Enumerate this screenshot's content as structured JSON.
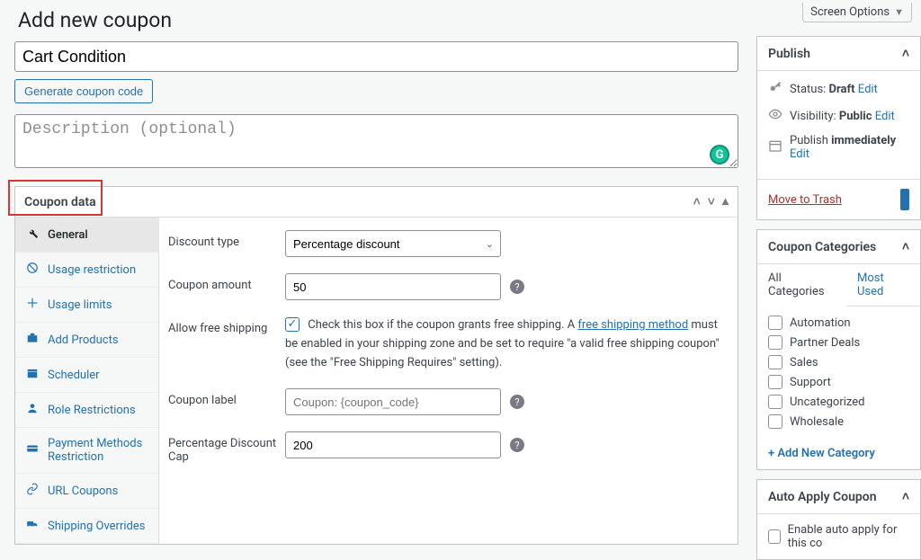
{
  "screen_options_label": "Screen Options",
  "page_title": "Add new coupon",
  "title_value": "Cart Condition",
  "generate_label": "Generate coupon code",
  "description_placeholder": "Description (optional)",
  "coupon_data_head": "Coupon data",
  "tabs": {
    "general": "General",
    "usage_restriction": "Usage restriction",
    "usage_limits": "Usage limits",
    "add_products": "Add Products",
    "scheduler": "Scheduler",
    "role_restrictions": "Role Restrictions",
    "payment_methods": "Payment Methods Restriction",
    "url_coupons": "URL Coupons",
    "shipping_overrides": "Shipping Overrides"
  },
  "form": {
    "discount_type_label": "Discount type",
    "discount_type_value": "Percentage discount",
    "coupon_amount_label": "Coupon amount",
    "coupon_amount_value": "50",
    "free_shipping_label": "Allow free shipping",
    "free_shipping_text_before": "Check this box if the coupon grants free shipping. A ",
    "free_shipping_link": "free shipping method",
    "free_shipping_text_after": " must be enabled in your shipping zone and be set to require \"a valid free shipping coupon\" (see the \"Free Shipping Requires\" setting).",
    "coupon_label_label": "Coupon label",
    "coupon_label_placeholder": "Coupon: {coupon_code}",
    "percentage_cap_label": "Percentage Discount Cap",
    "percentage_cap_value": "200"
  },
  "publish": {
    "heading": "Publish",
    "status_label": "Status: ",
    "status_value": "Draft",
    "visibility_label": "Visibility: ",
    "visibility_value": "Public",
    "publish_label": "Publish ",
    "publish_value": "immediately",
    "edit": "Edit",
    "trash": "Move to Trash"
  },
  "categories": {
    "heading": "Coupon Categories",
    "all": "All Categories",
    "most_used": "Most Used",
    "items": [
      "Automation",
      "Partner Deals",
      "Sales",
      "Support",
      "Uncategorized",
      "Wholesale"
    ],
    "add_new": "+ Add New Category"
  },
  "auto_apply": {
    "heading": "Auto Apply Coupon",
    "label": "Enable auto apply for this co"
  }
}
